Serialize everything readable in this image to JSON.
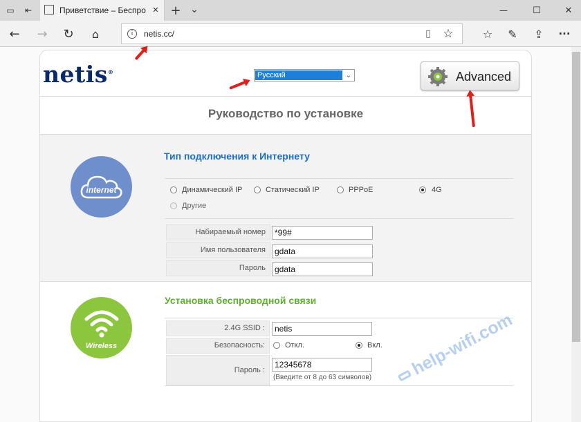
{
  "browser": {
    "tab_title": "Приветствие – Беспро",
    "tab_close": "✕",
    "new_tab": "+",
    "tab_list": "⌄",
    "url": "netis.cc/",
    "win_min": "—",
    "win_max": "☐",
    "win_close": "✕",
    "menu_dots": "···"
  },
  "header": {
    "logo_text": "netis",
    "logo_mark": "®",
    "language": "Русский",
    "advanced_label": "Advanced"
  },
  "page_title": "Руководство по установке",
  "internet": {
    "icon_text": "internet",
    "section_title": "Тип подключения к Интернету",
    "options": [
      {
        "label": "Динамический IP",
        "selected": false
      },
      {
        "label": "Статический IP",
        "selected": false
      },
      {
        "label": "PPPoE",
        "selected": false
      },
      {
        "label": "4G",
        "selected": true
      },
      {
        "label": "Другие",
        "selected": false,
        "disabled": true
      }
    ],
    "fields": [
      {
        "label": "Набираемый номер",
        "value": "*99#"
      },
      {
        "label": "Имя пользователя",
        "value": "gdata"
      },
      {
        "label": "Пароль",
        "value": "gdata"
      }
    ]
  },
  "wireless": {
    "icon_text": "Wireless",
    "section_title": "Установка беспроводной связи",
    "ssid_label": "2.4G SSID :",
    "ssid_value": "netis",
    "security_label": "Безопасность:",
    "security_off": "Откл.",
    "security_on": "Вкл.",
    "password_label": "Пароль :",
    "password_value": "12345678",
    "password_hint": "(Введите от 8 до 63 символов)"
  },
  "watermark": "help-wifi.com",
  "colors": {
    "brand_blue": "#0b2a6e",
    "section_blue": "#1f6fbd",
    "section_green": "#5bb12a",
    "internet_circle": "#6f8fcc",
    "wireless_circle": "#8cc63f",
    "annotation_red": "#e0201b"
  }
}
